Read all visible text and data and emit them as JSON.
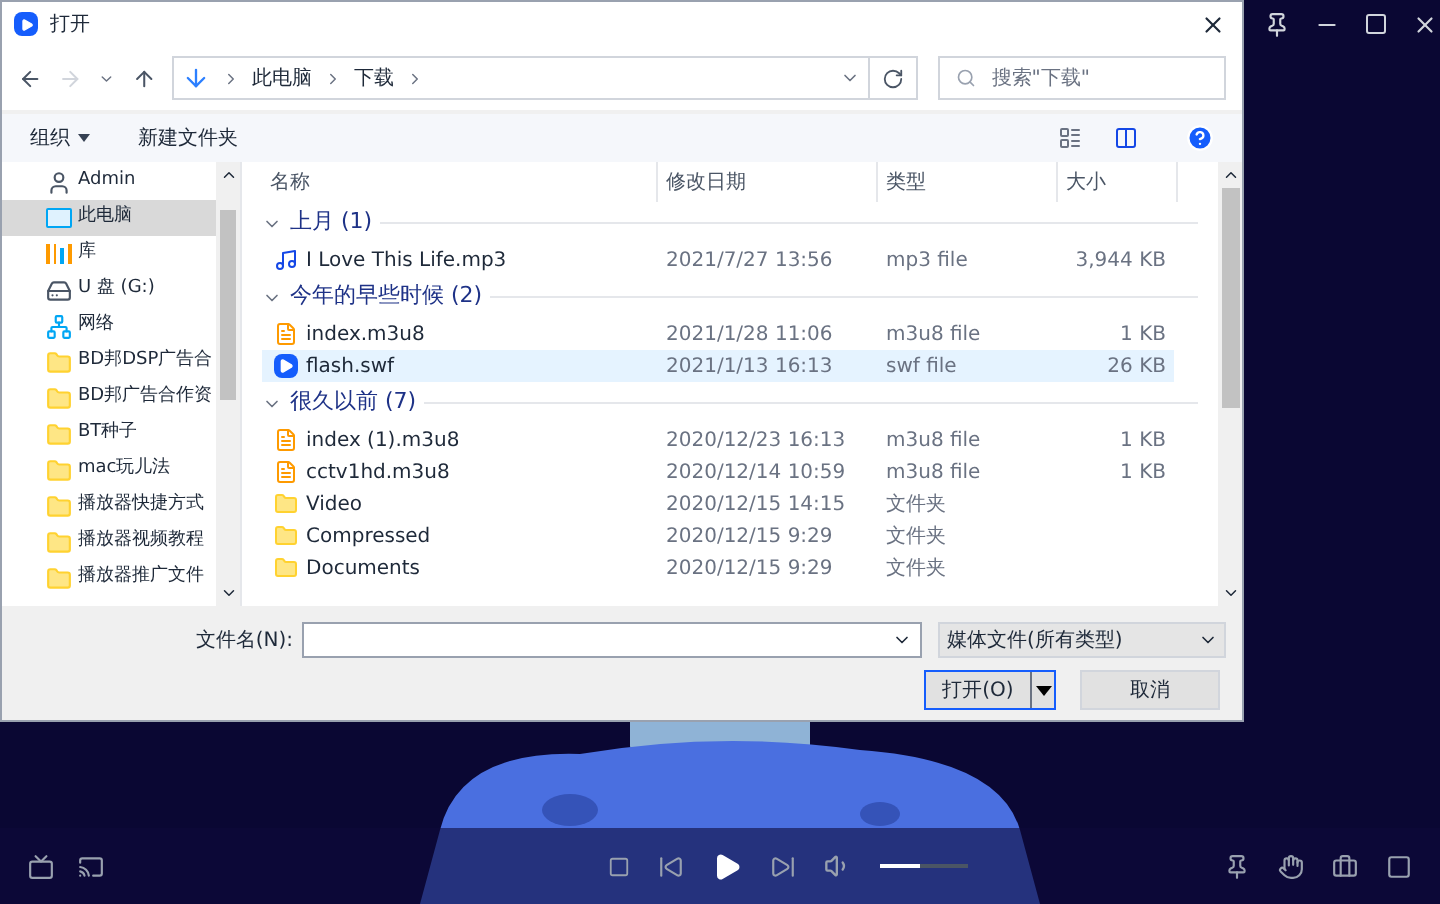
{
  "dialog": {
    "title": "打开",
    "breadcrumbs": [
      "此电脑",
      "下载"
    ],
    "search": {
      "placeholder": "搜索\"下载\""
    },
    "toolbar": {
      "organize": "组织",
      "new_folder": "新建文件夹"
    },
    "sidebar": {
      "items": [
        {
          "label": "Admin",
          "kind": "user",
          "selected": false
        },
        {
          "label": "此电脑",
          "kind": "pc",
          "selected": true
        },
        {
          "label": "库",
          "kind": "library",
          "selected": false
        },
        {
          "label": "U 盘 (G:)",
          "kind": "drive",
          "selected": false
        },
        {
          "label": "网络",
          "kind": "network",
          "selected": false
        },
        {
          "label": "BD邦DSP广告合",
          "kind": "folder",
          "selected": false
        },
        {
          "label": "BD邦广告合作资",
          "kind": "folder",
          "selected": false
        },
        {
          "label": "BT种子",
          "kind": "folder",
          "selected": false
        },
        {
          "label": "mac玩儿法",
          "kind": "folder",
          "selected": false
        },
        {
          "label": "播放器快捷方式",
          "kind": "folder",
          "selected": false
        },
        {
          "label": "播放器视频教程",
          "kind": "folder",
          "selected": false
        },
        {
          "label": "播放器推广文件",
          "kind": "folder",
          "selected": false
        }
      ]
    },
    "columns": [
      "名称",
      "修改日期",
      "类型",
      "大小"
    ],
    "groups": [
      {
        "title": "上月 (1)",
        "files": [
          {
            "name": "I Love This Life.mp3",
            "kind": "audio",
            "date": "2021/7/27 13:56",
            "type": "mp3 file",
            "size": "3,944 KB",
            "selected": false
          }
        ]
      },
      {
        "title": "今年的早些时候 (2)",
        "files": [
          {
            "name": "index.m3u8",
            "kind": "playlist",
            "date": "2021/1/28 11:06",
            "type": "m3u8 file",
            "size": "1 KB",
            "selected": false
          },
          {
            "name": "flash.swf",
            "kind": "video",
            "date": "2021/1/13 16:13",
            "type": "swf file",
            "size": "26 KB",
            "selected": true
          }
        ]
      },
      {
        "title": "很久以前 (7)",
        "files": [
          {
            "name": "index (1).m3u8",
            "kind": "playlist",
            "date": "2020/12/23 16:13",
            "type": "m3u8 file",
            "size": "1 KB",
            "selected": false
          },
          {
            "name": "cctv1hd.m3u8",
            "kind": "playlist",
            "date": "2020/12/14 10:59",
            "type": "m3u8 file",
            "size": "1 KB",
            "selected": false
          },
          {
            "name": "Video",
            "kind": "folder",
            "date": "2020/12/15 14:15",
            "type": "文件夹",
            "selected": false
          },
          {
            "name": "Compressed",
            "kind": "folder",
            "date": "2020/12/15 9:29",
            "type": "文件夹",
            "selected": false
          },
          {
            "name": "Documents",
            "kind": "folder",
            "date": "2020/12/15 9:29",
            "type": "文件夹",
            "selected": false
          }
        ]
      }
    ],
    "filename_label": "文件名(N):",
    "filetype": "媒体文件(所有类型)",
    "open_button": "打开(O)",
    "cancel_button": "取消"
  },
  "player": {
    "volume": {
      "level": 0.45
    }
  }
}
